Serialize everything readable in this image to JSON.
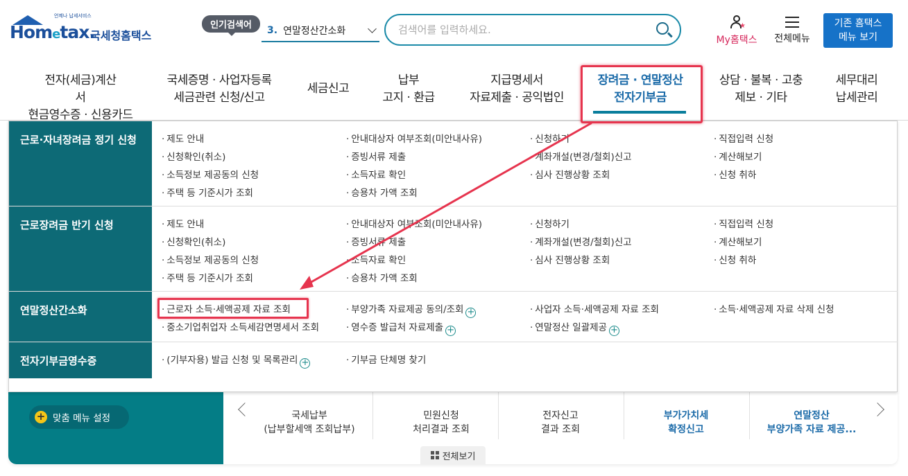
{
  "header": {
    "logo_small": "언제나 납세서비스",
    "logo_word_a": "Hom",
    "logo_word_e": "e",
    "logo_word_b": "tax.",
    "logo_kor": "국세청홈택스",
    "popular_badge": "인기검색어",
    "popular_num": "3.",
    "popular_term": "연말정산간소화",
    "search_placeholder": "검색어를 입력하세요.",
    "my_label": "My홈택스",
    "allmenu_label": "전체메뉴",
    "classic_line1": "기존 홈택스",
    "classic_line2": "메뉴 보기"
  },
  "nav": [
    {
      "l1": "전자(세금)계산서",
      "l2": "현금영수증 · 신용카드"
    },
    {
      "l1": "국세증명 · 사업자등록",
      "l2": "세금관련 신청/신고"
    },
    {
      "l1": "세금신고",
      "l2": ""
    },
    {
      "l1": "납부",
      "l2": "고지 · 환급"
    },
    {
      "l1": "지급명세서",
      "l2": "자료제출 · 공익법인"
    },
    {
      "l1": "장려금 · 연말정산",
      "l2": "전자기부금"
    },
    {
      "l1": "상담 · 불복 · 고충",
      "l2": "제보 · 기타"
    },
    {
      "l1": "세무대리",
      "l2": "납세관리"
    }
  ],
  "panel": {
    "r1": {
      "cat": "근로·자녀장려금 정기 신청",
      "links": [
        "제도 안내",
        "안내대상자 여부조회(미안내사유)",
        "신청하기",
        "직접입력 신청",
        "신청확인(취소)",
        "증빙서류 제출",
        "계좌개설(변경/철회)신고",
        "계산해보기",
        "소득정보 제공동의 신청",
        "소득자료 확인",
        "심사 진행상황 조회",
        "신청 취하",
        "주택 등 기준시가 조회",
        "승용차 가액 조회"
      ]
    },
    "r2": {
      "cat": "근로장려금 반기 신청",
      "links": [
        "제도 안내",
        "안내대상자 여부조회(미안내사유)",
        "신청하기",
        "직접입력 신청",
        "신청확인(취소)",
        "증빙서류 제출",
        "계좌개설(변경/철회)신고",
        "계산해보기",
        "소득정보 제공동의 신청",
        "소득자료 확인",
        "심사 진행상황 조회",
        "신청 취하",
        "주택 등 기준시가 조회",
        "승용차 가액 조회"
      ]
    },
    "r3": {
      "cat": "연말정산간소화",
      "links": [
        "근로자 소득·세액공제 자료 조회",
        "부양가족 자료제공 동의/조회",
        "사업자 소득·세액공제 자료 조회",
        "소득·세액공제 자료 삭제 신청",
        "중소기업취업자 소득세감면명세서 조회",
        "영수증 발급처 자료제출",
        "연말정산 일괄제공"
      ]
    },
    "r4": {
      "cat": "전자기부금영수증",
      "links": [
        "(기부자용) 발급 신청 및 목록관리",
        "기부금 단체명 찾기"
      ]
    }
  },
  "lower": {
    "fit_btn": "맞춤 메뉴 설정",
    "services": [
      {
        "l1": "국세납부",
        "l2": "(납부할세액 조회납부)",
        "bold": false
      },
      {
        "l1": "민원신청",
        "l2": "처리결과 조회",
        "bold": false
      },
      {
        "l1": "전자신고",
        "l2": "결과 조회",
        "bold": false
      },
      {
        "l1": "부가가치세",
        "l2": "확정신고",
        "bold": true
      },
      {
        "l1": "연말정산",
        "l2": "부양가족 자료 제공...",
        "bold": true
      }
    ],
    "see_all": "전체보기"
  },
  "colors": {
    "teal": "#0d6a76",
    "blue": "#1a6aa8",
    "annotation_red": "#e6344e"
  }
}
